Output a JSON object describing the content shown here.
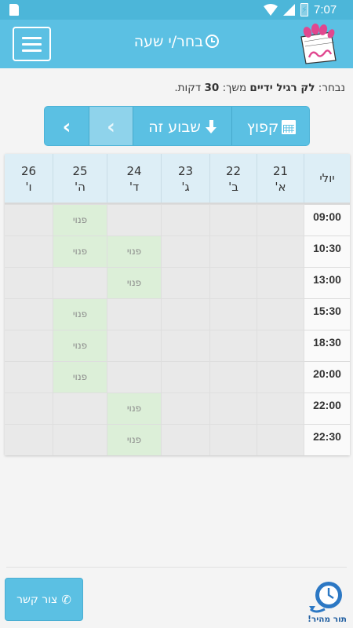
{
  "status_bar": {
    "time": "7:07"
  },
  "header": {
    "title": "בחר/י שעה"
  },
  "selected": {
    "prefix": "נבחר:",
    "service": "לק רגיל ידיים",
    "duration_label": "משך:",
    "duration_value": "30",
    "duration_unit": "דקות."
  },
  "nav": {
    "jump_label": "קפוץ",
    "this_week_label": "שבוע זה"
  },
  "schedule": {
    "month": "יולי",
    "days": [
      {
        "num": "21",
        "letter": "א'"
      },
      {
        "num": "22",
        "letter": "ב'"
      },
      {
        "num": "23",
        "letter": "ג'"
      },
      {
        "num": "24",
        "letter": "ד'"
      },
      {
        "num": "25",
        "letter": "ה'"
      },
      {
        "num": "26",
        "letter": "ו'"
      }
    ],
    "times": [
      "09:00",
      "10:30",
      "13:00",
      "15:30",
      "18:30",
      "20:00",
      "22:00",
      "22:30"
    ],
    "free_label": "פנוי",
    "free_slots": {
      "09:00": [
        "25"
      ],
      "10:30": [
        "24",
        "25"
      ],
      "13:00": [
        "24"
      ],
      "15:30": [
        "25"
      ],
      "18:30": [
        "25"
      ],
      "20:00": [
        "25"
      ],
      "22:00": [
        "24"
      ],
      "22:30": [
        "24"
      ]
    }
  },
  "footer": {
    "contact_label": "צור קשר",
    "quick_label": "תור מהיר!"
  },
  "colors": {
    "primary": "#5bc0e3",
    "free": "#dcefd8",
    "header_cells": "#ddeef6"
  }
}
